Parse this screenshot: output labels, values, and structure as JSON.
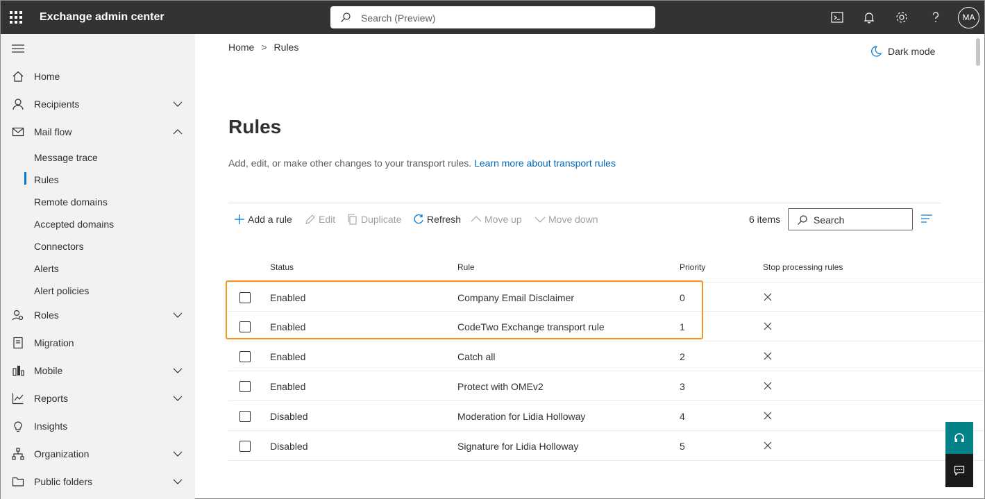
{
  "topbar": {
    "app_title": "Exchange admin center",
    "search_placeholder": "Search (Preview)",
    "avatar_initials": "MA",
    "icons": [
      "waffle-icon",
      "terminal-icon",
      "bell-icon",
      "gear-icon",
      "help-icon"
    ]
  },
  "sidebar": {
    "items": [
      {
        "label": "Home",
        "icon": "home-icon"
      },
      {
        "label": "Recipients",
        "icon": "person-icon",
        "expandable": true
      },
      {
        "label": "Mail flow",
        "icon": "mail-icon",
        "expanded": true
      },
      {
        "label": "Roles",
        "icon": "roles-icon",
        "expandable": true
      },
      {
        "label": "Migration",
        "icon": "migration-icon"
      },
      {
        "label": "Mobile",
        "icon": "mobile-icon",
        "expandable": true
      },
      {
        "label": "Reports",
        "icon": "reports-icon",
        "expandable": true
      },
      {
        "label": "Insights",
        "icon": "lightbulb-icon"
      },
      {
        "label": "Organization",
        "icon": "organization-icon",
        "expandable": true
      },
      {
        "label": "Public folders",
        "icon": "folder-icon",
        "expandable": true
      }
    ],
    "mail_flow_sub": [
      {
        "label": "Message trace"
      },
      {
        "label": "Rules",
        "selected": true
      },
      {
        "label": "Remote domains"
      },
      {
        "label": "Accepted domains"
      },
      {
        "label": "Connectors"
      },
      {
        "label": "Alerts"
      },
      {
        "label": "Alert policies"
      }
    ]
  },
  "breadcrumb": {
    "home": "Home",
    "sep": ">",
    "current": "Rules"
  },
  "dark_mode_label": "Dark mode",
  "page": {
    "title": "Rules",
    "description": "Add, edit, or make other changes to your transport rules.",
    "link": "Learn more about transport rules"
  },
  "toolbar": {
    "add": "Add a rule",
    "edit": "Edit",
    "duplicate": "Duplicate",
    "refresh": "Refresh",
    "move_up": "Move up",
    "move_down": "Move down",
    "items_count": "6 items",
    "search_placeholder": "Search"
  },
  "table": {
    "columns": [
      "Status",
      "Rule",
      "Priority",
      "Stop processing rules"
    ],
    "rows": [
      {
        "status": "Enabled",
        "rule": "Company Email Disclaimer",
        "priority": "0"
      },
      {
        "status": "Enabled",
        "rule": "CodeTwo Exchange transport rule",
        "priority": "1"
      },
      {
        "status": "Enabled",
        "rule": "Catch all",
        "priority": "2"
      },
      {
        "status": "Enabled",
        "rule": "Protect with OMEv2",
        "priority": "3"
      },
      {
        "status": "Disabled",
        "rule": "Moderation for Lidia Holloway",
        "priority": "4"
      },
      {
        "status": "Disabled",
        "rule": "Signature for Lidia Holloway",
        "priority": "5"
      }
    ]
  },
  "colors": {
    "accent": "#0078d4",
    "highlight": "#f7941d",
    "topbar": "#333333",
    "help_button": "#038387"
  }
}
